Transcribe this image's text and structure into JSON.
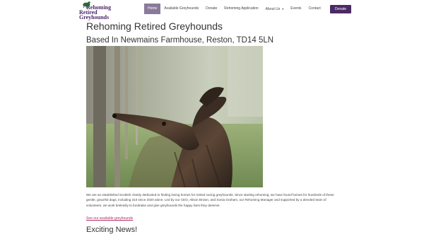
{
  "logo": {
    "line1": "Rehoming",
    "line2": "Retired Greyhounds"
  },
  "nav": [
    {
      "label": "Home",
      "active": true
    },
    {
      "label": "Available Greyhounds"
    },
    {
      "label": "Donate"
    },
    {
      "label": "Rehoming Application"
    },
    {
      "label": "About Us",
      "caret": "▾"
    },
    {
      "label": "Events"
    },
    {
      "label": "Contact"
    }
  ],
  "header_button": "Donate",
  "main": {
    "title": "Rehoming Retired Greyhounds",
    "subtitle": "Based In Newmains Farmhouse, Reston, TD14 5LN",
    "intro": "We are an established Scottish charity dedicated to finding loving homes for retired racing greyhounds. Since starting rehoming, we have found homes for hundreds of these gentle, graceful dogs, including 310 since 2020 alone. Led by our CEO, Alison Brown, and Sonia Graham, our Rehoming Manager and supported by a devoted team of volunteers, we work tirelessly to fundraise and give greyhounds the happy lives they deserve.",
    "link": "See our available greyhounds",
    "news_heading": "Exciting News!"
  },
  "colors": {
    "brand": "#4b2a63",
    "active_nav": "#8a7a9a",
    "link": "#b0306a"
  }
}
